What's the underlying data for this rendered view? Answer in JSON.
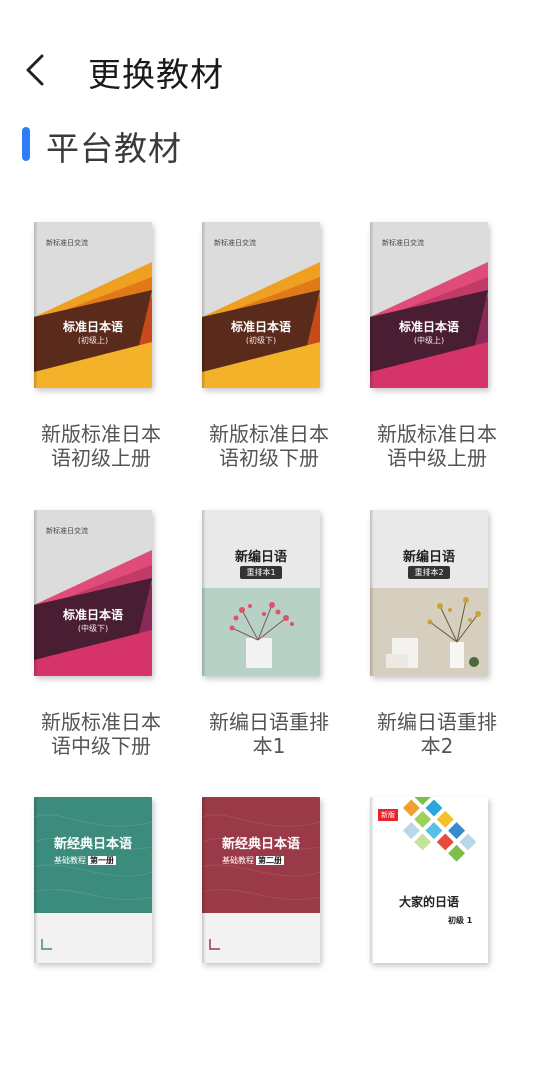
{
  "header": {
    "title": "更换教材",
    "back_icon": "chevron-left-icon"
  },
  "section": {
    "title": "平台教材",
    "accent_color": "#2f7cf6"
  },
  "books": [
    {
      "title": "新版标准日本语初级上册",
      "cover": {
        "publisher": "新标准日交流",
        "main": "标准日本语",
        "sub": "(初级上)"
      }
    },
    {
      "title": "新版标准日本语初级下册",
      "cover": {
        "publisher": "新标准日交流",
        "main": "标准日本语",
        "sub": "(初级下)"
      }
    },
    {
      "title": "新版标准日本语中级上册",
      "cover": {
        "publisher": "新标准日交流",
        "main": "标准日本语",
        "sub": "(中级上)"
      }
    },
    {
      "title": "新版标准日本语中级下册",
      "cover": {
        "publisher": "新标准日交流",
        "main": "标准日本语",
        "sub": "(中级下)"
      }
    },
    {
      "title": "新编日语重排本1",
      "cover": {
        "main": "新编日语",
        "badge": "重排本1"
      }
    },
    {
      "title": "新编日语重排本2",
      "cover": {
        "main": "新编日语",
        "badge": "重排本2"
      }
    },
    {
      "title": "",
      "cover": {
        "main": "新经典日本语",
        "sub": "基础教程",
        "badge": "第一册"
      }
    },
    {
      "title": "",
      "cover": {
        "main": "新经典日本语",
        "sub": "基础教程",
        "badge": "第二册"
      }
    },
    {
      "title": "",
      "cover": {
        "tag": "新版",
        "main": "大家的日语",
        "sub": "初级 1"
      }
    }
  ]
}
